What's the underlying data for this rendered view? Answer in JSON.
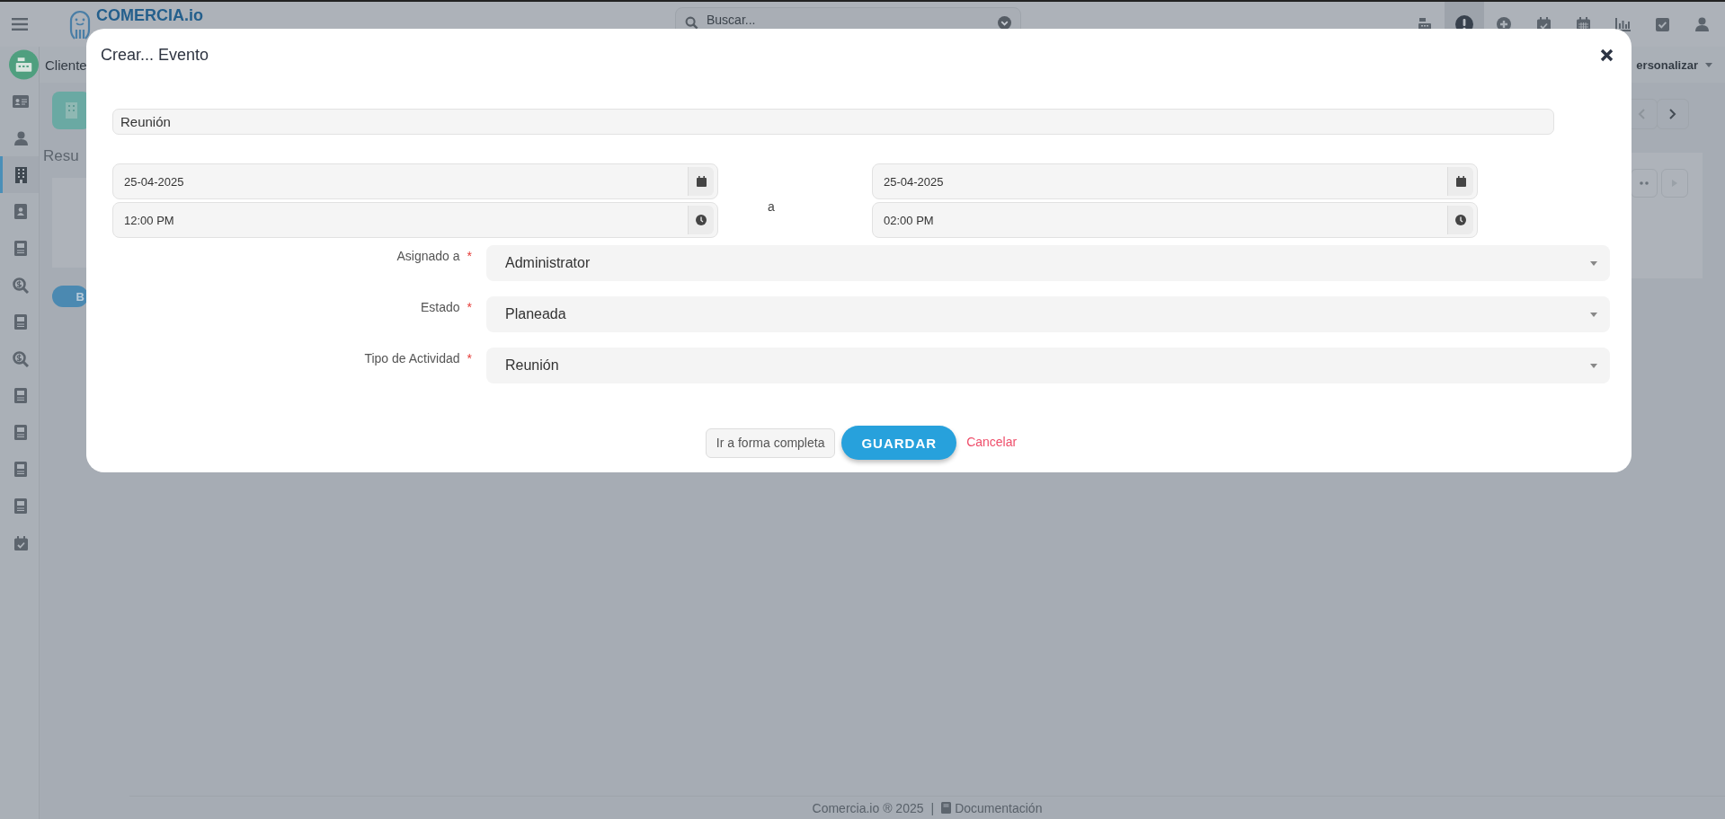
{
  "topbar": {
    "logo": "COMERCIA.io",
    "search": {
      "placeholder": "Buscar..."
    },
    "tools": [
      {
        "selected": false
      },
      {
        "selected": true
      },
      {
        "selected": false
      },
      {
        "selected": false
      },
      {
        "selected": false
      },
      {
        "selected": false
      },
      {
        "selected": false
      },
      {
        "selected": false
      }
    ]
  },
  "breadcrumb": "Cliente",
  "customize": "ersonalizar",
  "tab_fragment": "Resu",
  "button_fragment": "B",
  "sidebar": {
    "items": [
      {
        "selected": false
      },
      {
        "selected": false
      },
      {
        "selected": true
      },
      {
        "selected": false
      },
      {
        "selected": false
      },
      {
        "selected": false
      },
      {
        "selected": false
      },
      {
        "selected": false
      },
      {
        "selected": false
      },
      {
        "selected": false
      },
      {
        "selected": false
      },
      {
        "selected": false
      },
      {
        "selected": false
      }
    ]
  },
  "modal": {
    "title": "Crear... Evento",
    "subject": {
      "value": "Reunión"
    },
    "start": {
      "date": "25-04-2025",
      "time": "12:00 PM"
    },
    "separator": "a",
    "end": {
      "date": "25-04-2025",
      "time": "02:00 PM"
    },
    "fields": [
      {
        "label": "Asignado a",
        "required_mark": "*",
        "value": "Administrator"
      },
      {
        "label": "Estado",
        "required_mark": "*",
        "value": "Planeada"
      },
      {
        "label": "Tipo de Actividad",
        "required_mark": "*",
        "value": "Reunión"
      }
    ],
    "buttons": {
      "full_form": "Ir a forma completa",
      "save": "GUARDAR",
      "cancel": "Cancelar"
    }
  },
  "footer": {
    "copyright": "Comercia.io ® 2025",
    "separator": "|",
    "link": "Documentación"
  }
}
